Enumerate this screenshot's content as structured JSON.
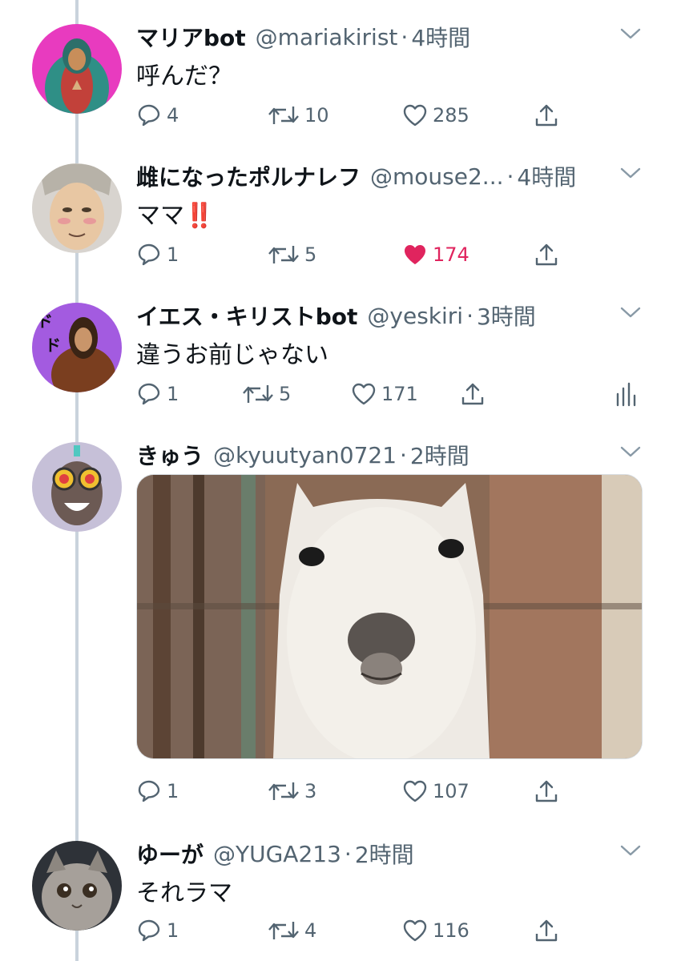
{
  "colors": {
    "like_active": "#e0245e",
    "muted_text": "#536471",
    "thread_line": "#c9d3dc"
  },
  "tweets": [
    {
      "name": "マリアbot",
      "handle": "@mariakirist",
      "dot": "·",
      "time": "4時間",
      "text": "呼んだ？",
      "replies": "4",
      "retweets": "10",
      "likes": "285",
      "liked": false
    },
    {
      "name": "雌になったポルナレフ",
      "handle": "@mouse2...",
      "dot": "·",
      "time": "4時間",
      "text": "ママ‼️",
      "replies": "1",
      "retweets": "5",
      "likes": "174",
      "liked": true
    },
    {
      "name": "イエス・キリストbot",
      "handle": "@yeskiri",
      "dot": "·",
      "time": "3時間",
      "text": "違うお前じゃない",
      "replies": "1",
      "retweets": "5",
      "likes": "171",
      "liked": false
    },
    {
      "name": "きゅう",
      "handle": "@kyuutyan0721",
      "dot": "·",
      "time": "2時間",
      "text": "",
      "replies": "1",
      "retweets": "3",
      "likes": "107",
      "liked": false
    },
    {
      "name": "ゆーが",
      "handle": "@YUGA213",
      "dot": "·",
      "time": "2時間",
      "text": "それラマ",
      "replies": "1",
      "retweets": "4",
      "likes": "116",
      "liked": false
    }
  ]
}
